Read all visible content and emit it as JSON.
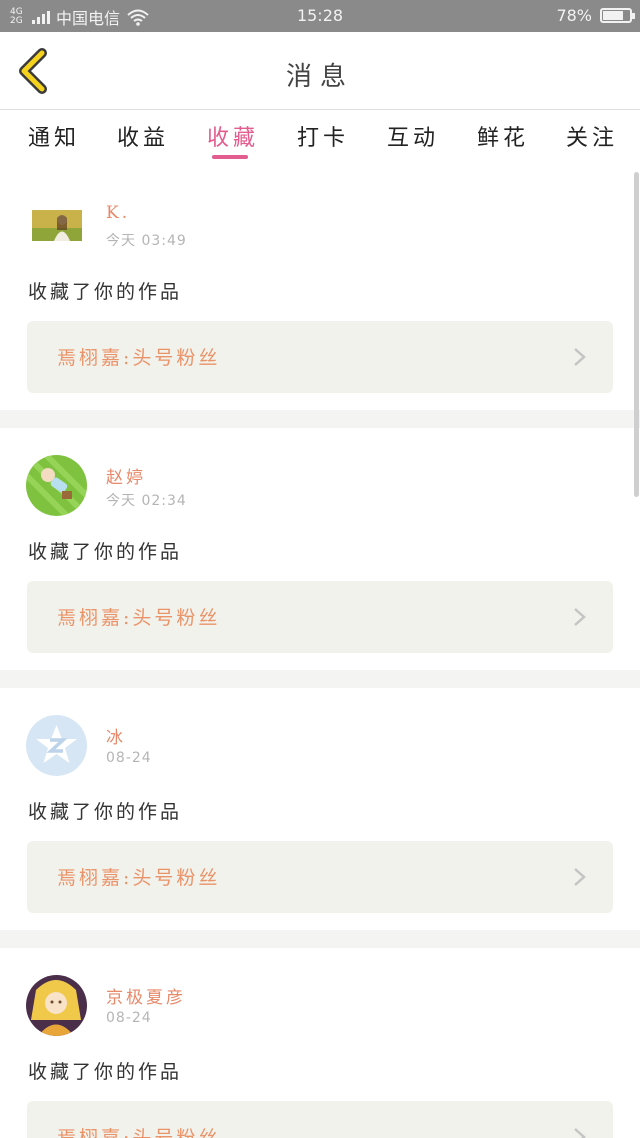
{
  "status_bar": {
    "network_top": "4G",
    "network_bottom": "2G",
    "carrier": "中国电信",
    "time": "15:28",
    "battery": "78%",
    "battery_level": 0.78
  },
  "header": {
    "title": "消息"
  },
  "tabs": [
    {
      "label": "通知"
    },
    {
      "label": "收益"
    },
    {
      "label": "收藏"
    },
    {
      "label": "打卡"
    },
    {
      "label": "互动"
    },
    {
      "label": "鲜花"
    },
    {
      "label": "关注"
    }
  ],
  "active_tab": "收藏",
  "messages": [
    {
      "username": "K.",
      "time": "今天 03:49",
      "action": "收藏了你的作品",
      "work_title": "焉栩嘉:头号粉丝"
    },
    {
      "username": "赵婷",
      "time": "今天 02:34",
      "action": "收藏了你的作品",
      "work_title": "焉栩嘉:头号粉丝"
    },
    {
      "username": "冰",
      "time": "08-24",
      "action": "收藏了你的作品",
      "work_title": "焉栩嘉:头号粉丝"
    },
    {
      "username": "京极夏彦",
      "time": "08-24",
      "action": "收藏了你的作品",
      "work_title": "焉栩嘉:头号粉丝"
    }
  ],
  "colors": {
    "accent": "#e35c8e",
    "username": "#e8896a",
    "work_title": "#eb9368",
    "back_icon": "#f5d21c"
  }
}
